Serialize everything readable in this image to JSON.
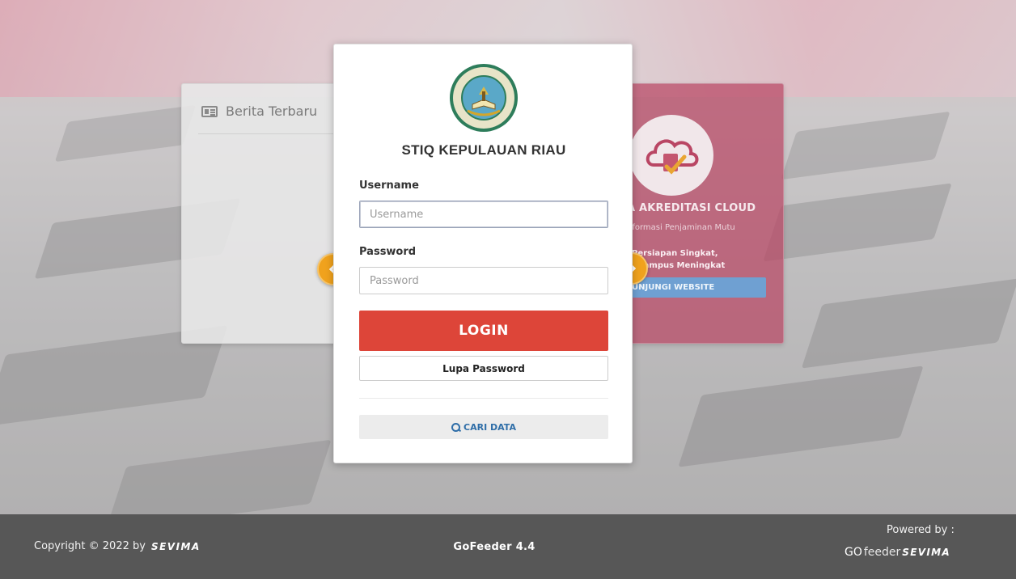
{
  "news_card": {
    "title": "Berita Terbaru",
    "icon": "newspaper-icon"
  },
  "promo_card": {
    "title": "A AKREDITASI CLOUD",
    "subtitle": "nformasi Penjaminan Mutu",
    "tagline_1": "Persiapan Singkat,",
    "tagline_2": "i Kampus Meningkat",
    "button_label": "UNJUNGI WEBSITE",
    "icon": "cloud-certificate-icon"
  },
  "login": {
    "institution_name": "STIQ KEPULAUAN RIAU",
    "logo_text": "SEKOLAH TINGGI ILMU AL-QURAN KEPULAUAN RIAU",
    "username_label": "Username",
    "username_placeholder": "Username",
    "username_value": "",
    "password_label": "Password",
    "password_placeholder": "Password",
    "password_value": "",
    "login_button": "LOGIN",
    "forgot_button": "Lupa Password",
    "search_button": "CARI DATA"
  },
  "carousel": {
    "prev_icon": "chevron-left-icon",
    "next_icon": "chevron-right-icon"
  },
  "footer": {
    "copyright": "Copyright © 2022 by",
    "brand": "SEVIMA",
    "version": "GoFeeder 4.4",
    "powered_by": "Powered by :",
    "powered_go": "GO",
    "powered_feeder": "feeder",
    "powered_brand": "SEVIMA"
  },
  "colors": {
    "login_red": "#dd4539",
    "arrow_orange": "#f0a21d",
    "link_blue": "#2f6ea8",
    "footer_gray": "#575757",
    "promo_pink": "#b94664"
  }
}
